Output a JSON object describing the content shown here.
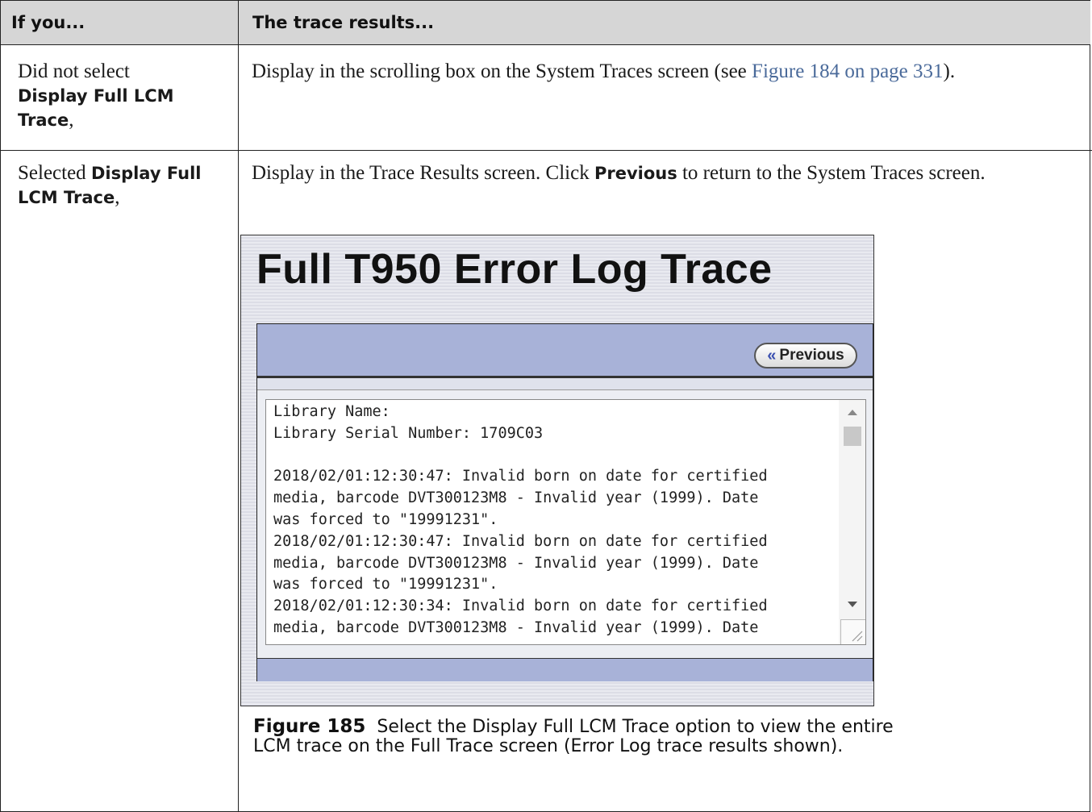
{
  "table": {
    "header": {
      "col1": "If you...",
      "col2": "The trace results..."
    },
    "row1": {
      "col1_prefix": "Did not select",
      "col1_bold": "Display Full LCM Trace",
      "col1_suffix": ",",
      "col2_text": "Display in the scrolling box on the System Traces screen (see ",
      "col2_link": "Figure 184 on page 331",
      "col2_end": ")."
    },
    "row2": {
      "col1_prefix": "Selected",
      "col1_bold": "Display Full LCM Trace",
      "col1_suffix": ",",
      "col2_text1": "Display in the Trace Results screen. Click ",
      "col2_bold": "Previous",
      "col2_text2": " to return to the System Traces screen."
    }
  },
  "screenshot": {
    "title": "Full T950 Error Log Trace",
    "previous_label": "Previous",
    "previous_glyph": "«",
    "trace_lines": [
      "Library Name:",
      "Library Serial Number: 1709C03",
      "",
      "2018/02/01:12:30:47: Invalid born on date for certified",
      "media, barcode DVT300123M8 - Invalid year (1999). Date",
      "was forced to \"19991231\".",
      "2018/02/01:12:30:47: Invalid born on date for certified",
      "media, barcode DVT300123M8 - Invalid year (1999). Date",
      "was forced to \"19991231\".",
      "2018/02/01:12:30:34: Invalid born on date for certified",
      "media, barcode DVT300123M8 - Invalid year (1999). Date"
    ],
    "colors": {
      "panel_header": "#a8b2d8",
      "button_chevron": "#3a4fb0"
    }
  },
  "caption": {
    "label": "Figure 185",
    "text": "Select the Display Full LCM Trace option to view the entire LCM trace on the Full Trace screen (Error Log trace results shown)."
  }
}
